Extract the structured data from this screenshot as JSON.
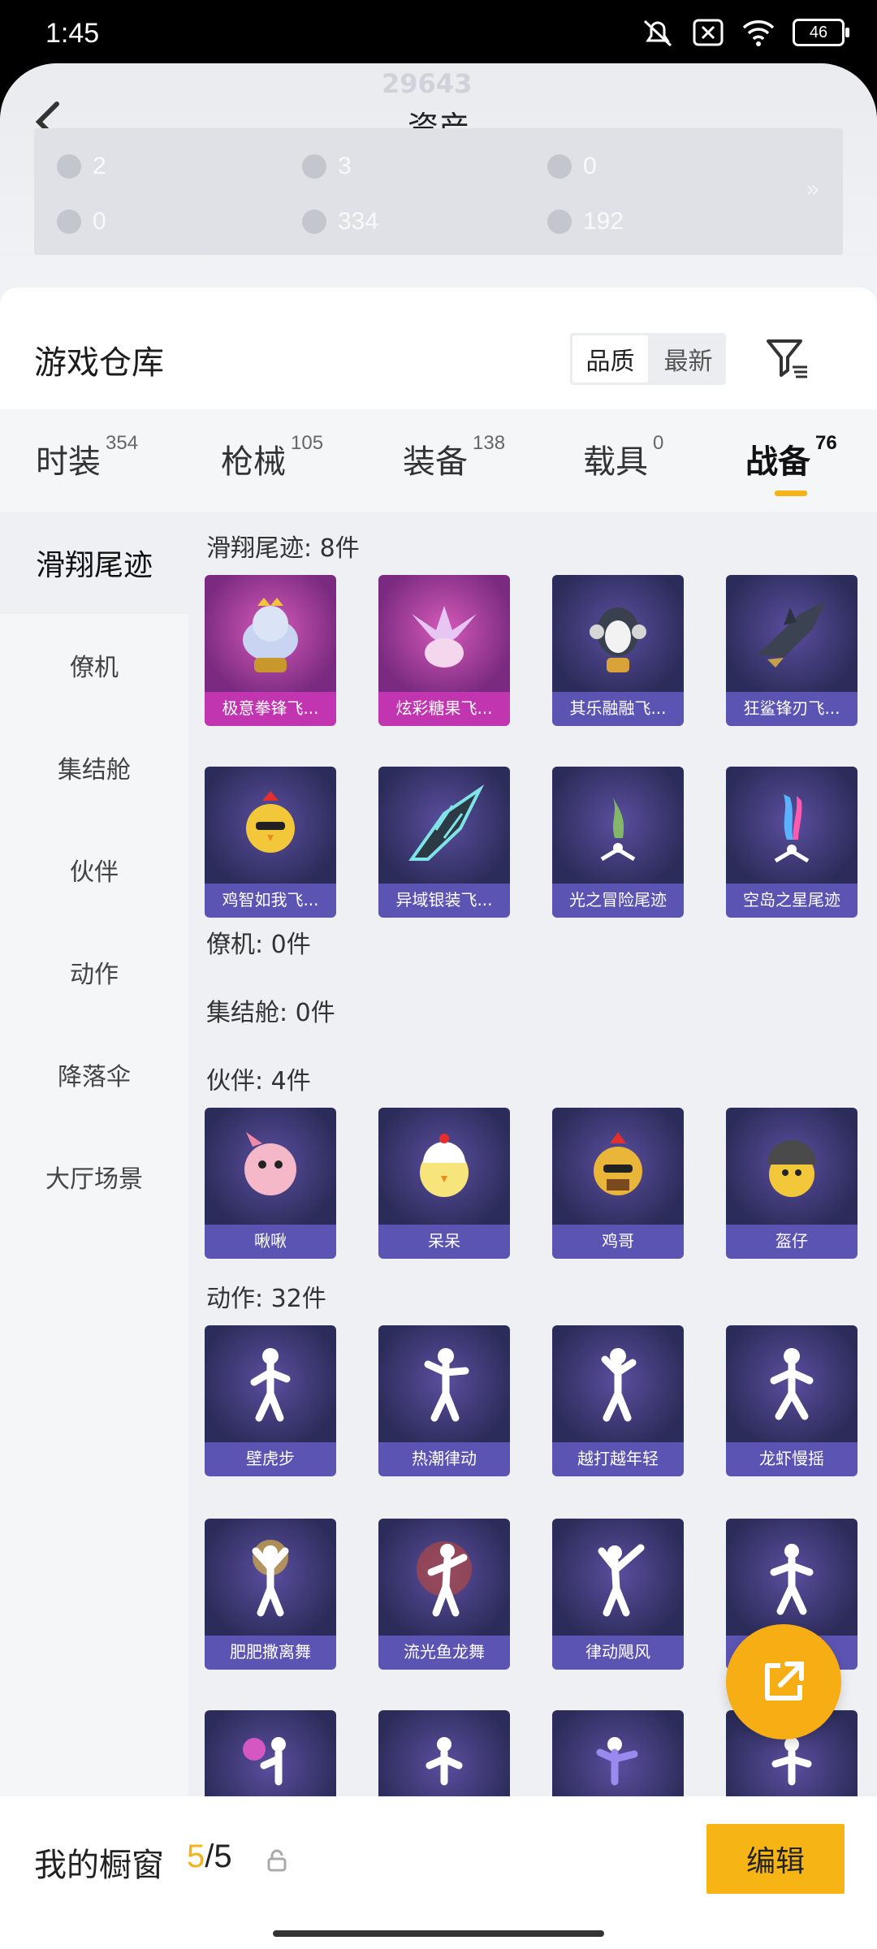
{
  "status_bar": {
    "time": "1:45",
    "battery": "46"
  },
  "header": {
    "title": "资产",
    "ghost_values": [
      "29643"
    ],
    "assets": [
      {
        "icon": "card-icon",
        "value": "2"
      },
      {
        "icon": "coin-icon",
        "value": "3"
      },
      {
        "icon": "coin-icon",
        "value": "0"
      },
      {
        "icon": "ticket-icon",
        "value": "0"
      },
      {
        "icon": "coin-icon",
        "value": "334"
      },
      {
        "icon": "coin-icon",
        "value": "192"
      }
    ],
    "more": "»"
  },
  "warehouse": {
    "title": "游戏仓库",
    "sort": [
      "品质",
      "最新"
    ]
  },
  "tabs": [
    {
      "label": "时装",
      "count": "354"
    },
    {
      "label": "枪械",
      "count": "105"
    },
    {
      "label": "装备",
      "count": "138"
    },
    {
      "label": "载具",
      "count": "0"
    },
    {
      "label": "战备",
      "count": "76"
    }
  ],
  "sidebar": [
    "滑翔尾迹",
    "僚机",
    "集结舱",
    "伙伴",
    "动作",
    "降落伞",
    "大厅场景"
  ],
  "sections": {
    "trail": {
      "title": "滑翔尾迹: 8件",
      "items": [
        "极意拳锋飞...",
        "炫彩糖果飞...",
        "其乐融融飞...",
        "狂鲨锋刃飞...",
        "鸡智如我飞...",
        "异域银装飞...",
        "光之冒险尾迹",
        "空岛之星尾迹"
      ]
    },
    "wingman": {
      "title": "僚机: 0件"
    },
    "capsule": {
      "title": "集结舱: 0件"
    },
    "partner": {
      "title": "伙伴: 4件",
      "items": [
        "啾啾",
        "呆呆",
        "鸡哥",
        "盔仔"
      ]
    },
    "action": {
      "title": "动作: 32件",
      "items": [
        "壁虎步",
        "热潮律动",
        "越打越年轻",
        "龙虾慢摇",
        "肥肥撒离舞",
        "流光鱼龙舞",
        "律动飓风",
        ""
      ]
    }
  },
  "bottom_bar": {
    "title": "我的橱窗",
    "current": "5",
    "sep_total": "/5",
    "edit": "编辑"
  },
  "colors": {
    "accent": "#f7b515",
    "purple": "#5c54b2",
    "pink": "#c235b0"
  }
}
